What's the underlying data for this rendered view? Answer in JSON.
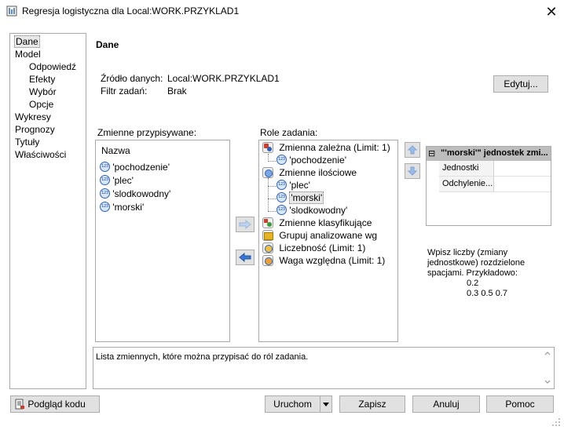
{
  "window": {
    "title": "Regresja logistyczna  dla Local:WORK.PRZYKLAD1",
    "close_glyph": "✕"
  },
  "nav": {
    "items": [
      {
        "label": "Dane",
        "level": 0,
        "selected": true
      },
      {
        "label": "Model",
        "level": 0
      },
      {
        "label": "Odpowiedź",
        "level": 1
      },
      {
        "label": "Efekty",
        "level": 1
      },
      {
        "label": "Wybór",
        "level": 1
      },
      {
        "label": "Opcje",
        "level": 1
      },
      {
        "label": "Wykresy",
        "level": 0
      },
      {
        "label": "Prognozy",
        "level": 0
      },
      {
        "label": "Tytuły",
        "level": 0
      },
      {
        "label": "Właściwości",
        "level": 0
      }
    ]
  },
  "section": {
    "title": "Dane"
  },
  "source": {
    "data_label": "Źródło danych:",
    "data_value": "Local:WORK.PRZYKLAD1",
    "filter_label": "Filtr zadań:",
    "filter_value": "Brak",
    "edit_button": "Edytuj..."
  },
  "assignable": {
    "label": "Zmienne przypisywane:",
    "column_header": "Nazwa",
    "items": [
      "'pochodzenie'",
      "'plec'",
      "'slodkowodny'",
      "'morski'"
    ]
  },
  "roles": {
    "label": "Role zadania:",
    "tree": [
      {
        "label": "Zmienna zależna  (Limit: 1)",
        "icon": "dep",
        "children": [
          "'pochodzenie'"
        ]
      },
      {
        "label": "Zmienne ilościowe",
        "icon": "num",
        "children": [
          "'plec'",
          "'morski'",
          "'slodkowodny'"
        ]
      },
      {
        "label": "Zmienne klasyfikujące",
        "icon": "cls",
        "children": []
      },
      {
        "label": "Grupuj analizowane wg",
        "icon": "grp",
        "children": []
      },
      {
        "label": "Liczebność  (Limit: 1)",
        "icon": "frq",
        "children": []
      },
      {
        "label": "Waga względna  (Limit: 1)",
        "icon": "wgt",
        "children": []
      }
    ]
  },
  "properties": {
    "header": "\"'morski'\" jednostek zmi...",
    "collapse_glyph": "⊟",
    "rows": [
      {
        "name": "Jednostki",
        "value": ""
      },
      {
        "name": "Odchylenie...",
        "value": ""
      }
    ]
  },
  "help": {
    "line1": "Wpisz liczby (zmiany",
    "line2": "jednostkowe) rozdzielone",
    "line3": "spacjami. Przykładowo:",
    "example1": "0.2",
    "example2": "0.3 0.5 0.7"
  },
  "description": {
    "text": "Lista zmiennych, które można przypisać do ról zadania."
  },
  "buttons": {
    "preview": "Podgląd kodu",
    "run": "Uruchom",
    "save": "Zapisz",
    "cancel": "Anuluj",
    "help": "Pomoc"
  },
  "colors": {
    "accent_blue": "#2b61b8",
    "arrow_blue": "#3a78d4"
  }
}
